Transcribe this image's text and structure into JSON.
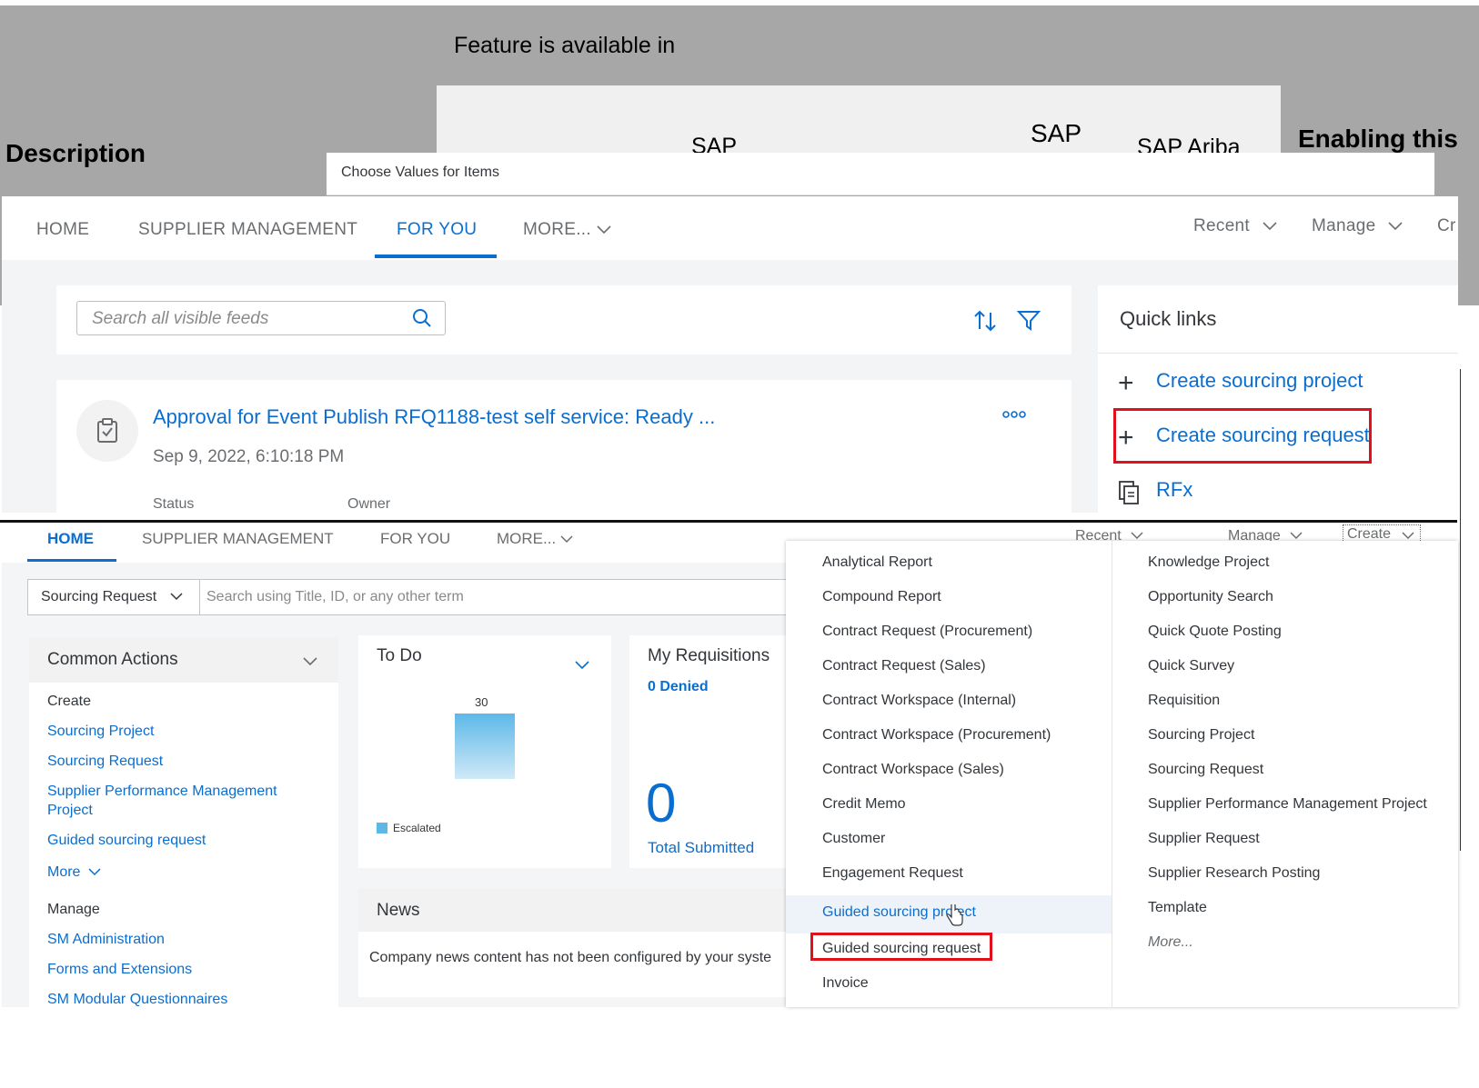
{
  "background_doc": {
    "top_label": "Feature is available in",
    "description_header": "Description",
    "col_sap_1": "SAP",
    "col_sap_2": "SAP",
    "col_sap_ariba": "SAP Ariba",
    "enabling_header": "Enabling this"
  },
  "top_screen": {
    "dialog_title": "Choose Values for Items",
    "nav": {
      "home": "HOME",
      "supplier_management": "SUPPLIER MANAGEMENT",
      "for_you": "FOR YOU",
      "more": "MORE...",
      "recent": "Recent",
      "manage": "Manage",
      "create_partial": "Cr"
    },
    "search_placeholder": "Search all visible feeds",
    "feed_card": {
      "title": "Approval for Event Publish RFQ1188-test self service: Ready ...",
      "date": "Sep 9, 2022, 6:10:18 PM",
      "status_label": "Status",
      "owner_label": "Owner"
    },
    "quick_links": {
      "title": "Quick links",
      "items": [
        "Create sourcing project",
        "Create sourcing request",
        "RFx"
      ]
    }
  },
  "bottom_screen": {
    "nav": {
      "home": "HOME",
      "supplier_management": "SUPPLIER MANAGEMENT",
      "for_you": "FOR YOU",
      "more": "MORE...",
      "recent": "Recent",
      "manage": "Manage",
      "create": "Create"
    },
    "search": {
      "selector": "Sourcing Request",
      "placeholder": "Search using Title, ID, or any other term"
    },
    "common_actions": {
      "title": "Common Actions",
      "create_label": "Create",
      "create_links": [
        "Sourcing Project",
        "Sourcing Request",
        "Supplier Performance Management",
        "Project",
        "Guided sourcing request"
      ],
      "more": "More",
      "manage_label": "Manage",
      "manage_links": [
        "SM Administration",
        "Forms and Extensions",
        "SM Modular Questionnaires"
      ]
    },
    "todo": {
      "title": "To Do",
      "bar_value": "30",
      "legend": "Escalated"
    },
    "my_requisitions": {
      "title": "My Requisitions",
      "denied": "0 Denied",
      "count": "0",
      "subtitle": "Total Submitted"
    },
    "news": {
      "title": "News",
      "body": "Company news content has not been configured by your syste"
    },
    "create_menu": {
      "left": [
        "Analytical Report",
        "Compound Report",
        "Contract Request (Procurement)",
        "Contract Request (Sales)",
        "Contract Workspace (Internal)",
        "Contract Workspace (Procurement)",
        "Contract Workspace (Sales)",
        "Credit Memo",
        "Customer",
        "Engagement Request",
        "Guided sourcing project",
        "Guided sourcing request",
        "Invoice"
      ],
      "right": [
        "Knowledge Project",
        "Opportunity Search",
        "Quick Quote Posting",
        "Quick Survey",
        "Requisition",
        "Sourcing Project",
        "Sourcing Request",
        "Supplier Performance Management Project",
        "Supplier Request",
        "Supplier Research Posting",
        "Template",
        "More..."
      ]
    }
  },
  "colors": {
    "accent": "#0a6ed1",
    "highlight_box": "#e0101c",
    "header_grey": "#a7a7a7"
  }
}
